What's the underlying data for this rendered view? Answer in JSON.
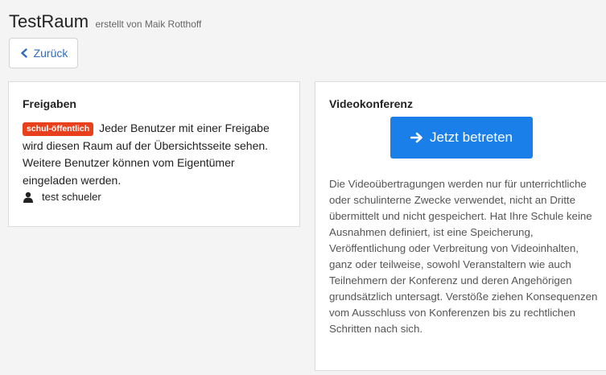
{
  "header": {
    "title": "TestRaum",
    "meta": "erstellt von Maik Rotthoff",
    "back_label": "Zurück"
  },
  "shares": {
    "heading": "Freigaben",
    "badge": "schul-öffentlich",
    "text": "Jeder Benutzer mit einer Freigabe wird diesen Raum auf der Übersichtsseite sehen. Weitere Benutzer können vom Eigentümer eingeladen werden.",
    "user_icon": "user-icon",
    "user": "test schueler"
  },
  "video": {
    "heading": "Videokonferenz",
    "join_label": "Jetzt betreten",
    "join_icon": "arrow-right-icon",
    "disclaimer": "Die Videoübertragungen werden nur für unterrichtliche oder schulinterne Zwecke verwendet, nicht an Dritte übermittelt und nicht gespeichert. Hat Ihre Schule keine Ausnahmen definiert, ist eine Speicherung, Veröffentlichung oder Verbreitung von Videoinhalten, ganz oder teilweise, sowohl Veranstaltern wie auch Teilnehmern der Konferenz und deren Angehörigen grundsätzlich untersagt. Verstöße ziehen Konsequenzen vom Ausschluss von Konferenzen bis zu rechtlichen Schritten nach sich."
  },
  "colors": {
    "accent": "#1a7fe8",
    "badge": "#e8401c",
    "link": "#2d6cc0",
    "background": "#f4f4f4"
  }
}
